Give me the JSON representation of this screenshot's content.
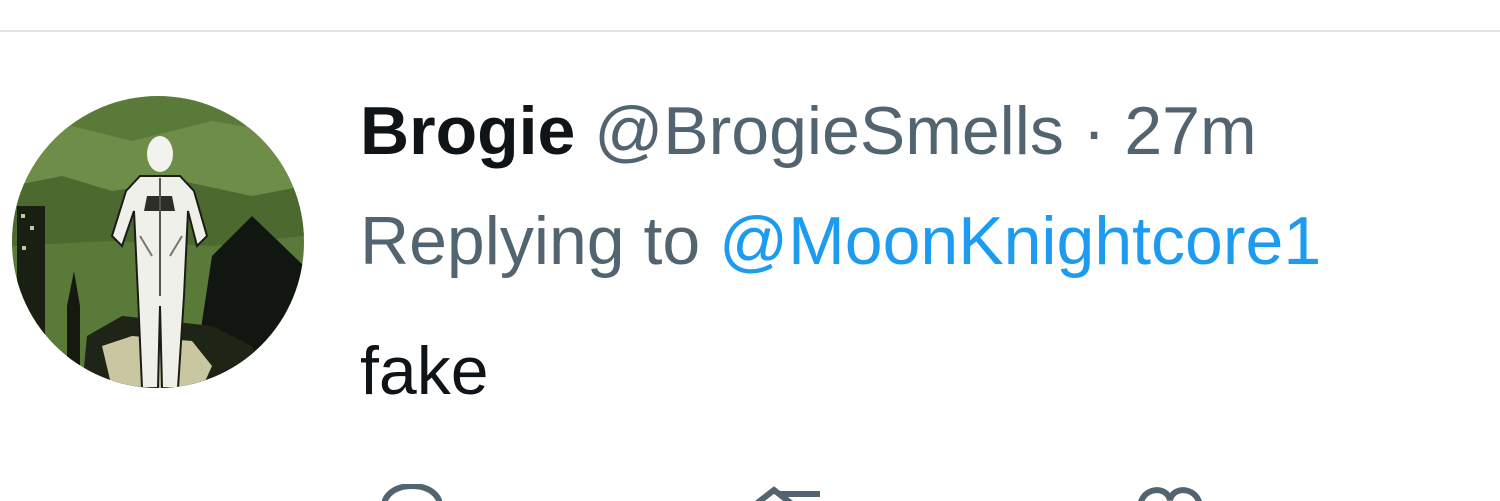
{
  "tweet": {
    "display_name": "Brogie",
    "handle": "@BrogieSmells",
    "separator": "·",
    "time": "27m",
    "replying_prefix": "Replying to",
    "replying_to": "@MoonKnightcore1",
    "text": "fake"
  },
  "actions": [
    {
      "name": "reply",
      "icon": "reply-icon"
    },
    {
      "name": "retweet",
      "icon": "retweet-icon"
    },
    {
      "name": "like",
      "icon": "heart-icon"
    }
  ],
  "colors": {
    "text": "#0f1419",
    "muted": "#536471",
    "link": "#1d9bf0",
    "divider": "#e1e4e8"
  }
}
